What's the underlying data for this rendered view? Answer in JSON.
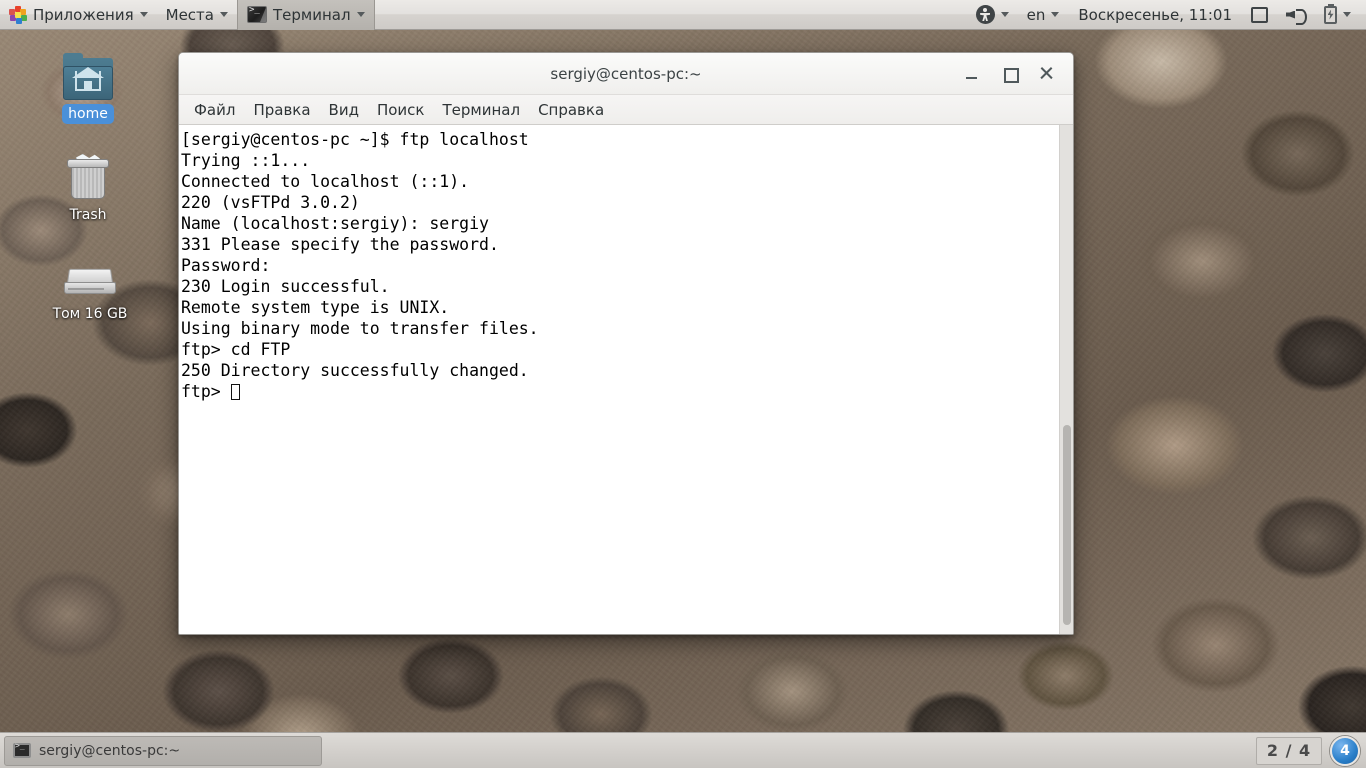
{
  "top_panel": {
    "applications_menu": {
      "label": "Приложения",
      "icon": "gnome-foot-icon"
    },
    "places_menu": {
      "label": "Места"
    },
    "active_app_menu": {
      "label": "Терминал",
      "icon": "terminal-icon"
    },
    "accessibility": {
      "icon": "accessibility-icon"
    },
    "keyboard_layout": {
      "label": "en"
    },
    "clock": {
      "label": "Воскресенье, 11:01"
    },
    "display_icon": "display-icon",
    "volume_icon": "volume-icon",
    "battery_icon": "battery-icon"
  },
  "desktop_icons": [
    {
      "name": "home",
      "label": "home",
      "icon": "home-folder-icon",
      "selected": true
    },
    {
      "name": "trash",
      "label": "Trash",
      "icon": "trash-icon",
      "selected": false
    },
    {
      "name": "volume",
      "label": "Том 16 GB",
      "icon": "drive-icon",
      "selected": false
    }
  ],
  "terminal_window": {
    "title": "sergiy@centos-pc:~",
    "window_controls": {
      "minimize": "_",
      "maximize": "□",
      "close": "✕"
    },
    "menu": [
      "Файл",
      "Правка",
      "Вид",
      "Поиск",
      "Терминал",
      "Справка"
    ],
    "lines": [
      "[sergiy@centos-pc ~]$ ftp localhost",
      "Trying ::1...",
      "Connected to localhost (::1).",
      "220 (vsFTPd 3.0.2)",
      "Name (localhost:sergiy): sergiy",
      "331 Please specify the password.",
      "Password:",
      "230 Login successful.",
      "Remote system type is UNIX.",
      "Using binary mode to transfer files.",
      "ftp> cd FTP",
      "250 Directory successfully changed."
    ],
    "prompt": "ftp> "
  },
  "bottom_panel": {
    "task": {
      "label": "sergiy@centos-pc:~",
      "icon": "terminal-icon"
    },
    "workspace_switcher": {
      "label": "2 / 4"
    },
    "workspace_count": {
      "label": "4"
    }
  },
  "colors": {
    "accent": "#4a90d9",
    "panel_bg": "#e3e1de",
    "terminal_bg": "#ffffff",
    "terminal_fg": "#000000",
    "workspace_badge": "#2a7fc9"
  }
}
